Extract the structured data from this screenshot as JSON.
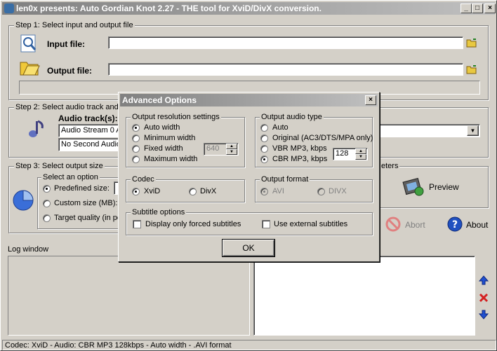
{
  "window": {
    "title": "len0x presents: Auto Gordian Knot 2.27 - THE tool for XviD/DivX conversion."
  },
  "step1": {
    "legend": "Step 1: Select input and output file",
    "input_label": "Input file:",
    "output_label": "Output file:",
    "input_value": "",
    "output_value": ""
  },
  "step2": {
    "legend": "Step 2: Select audio track and",
    "audio_label": "Audio track(s):",
    "track1": "Audio Stream 0 A",
    "track2": "No Second Audio"
  },
  "step3": {
    "legend": "Step 3: Select output size",
    "option_legend": "Select an option",
    "opt_predefined": "Predefined size:",
    "opt_custom": "Custom size (MB):",
    "opt_quality": "Target quality (in pe"
  },
  "right": {
    "legend_tail": "eters",
    "preview_label": "Preview",
    "abort_label": "Abort",
    "about_label": "About"
  },
  "log": {
    "label": "Log window"
  },
  "status": {
    "text": "Codec: XviD -  Audio: CBR MP3 128kbps -  Auto width - .AVI format"
  },
  "dialog": {
    "title": "Advanced Options",
    "res": {
      "legend": "Output resolution settings",
      "auto": "Auto width",
      "min": "Minimum width",
      "fixed": "Fixed width",
      "max": "Maximum width",
      "fixed_value": "640"
    },
    "audio": {
      "legend": "Output audio type",
      "auto": "Auto",
      "original": "Original (AC3/DTS/MPA only)",
      "vbr": "VBR MP3, kbps",
      "cbr": "CBR MP3, kbps",
      "cbr_value": "128"
    },
    "codec": {
      "legend": "Codec",
      "xvid": "XviD",
      "divx": "DivX"
    },
    "format": {
      "legend": "Output format",
      "avi": "AVI",
      "divx": "DIVX"
    },
    "subs": {
      "legend": "Subtitle options",
      "forced": "Display only forced subtitles",
      "external": "Use external subtitles"
    },
    "ok": "OK"
  },
  "colors": {
    "title_gradient_start": "#808080",
    "face": "#d4d0c8",
    "accent_blue": "#1e4fd8",
    "delete_red": "#d42020"
  }
}
